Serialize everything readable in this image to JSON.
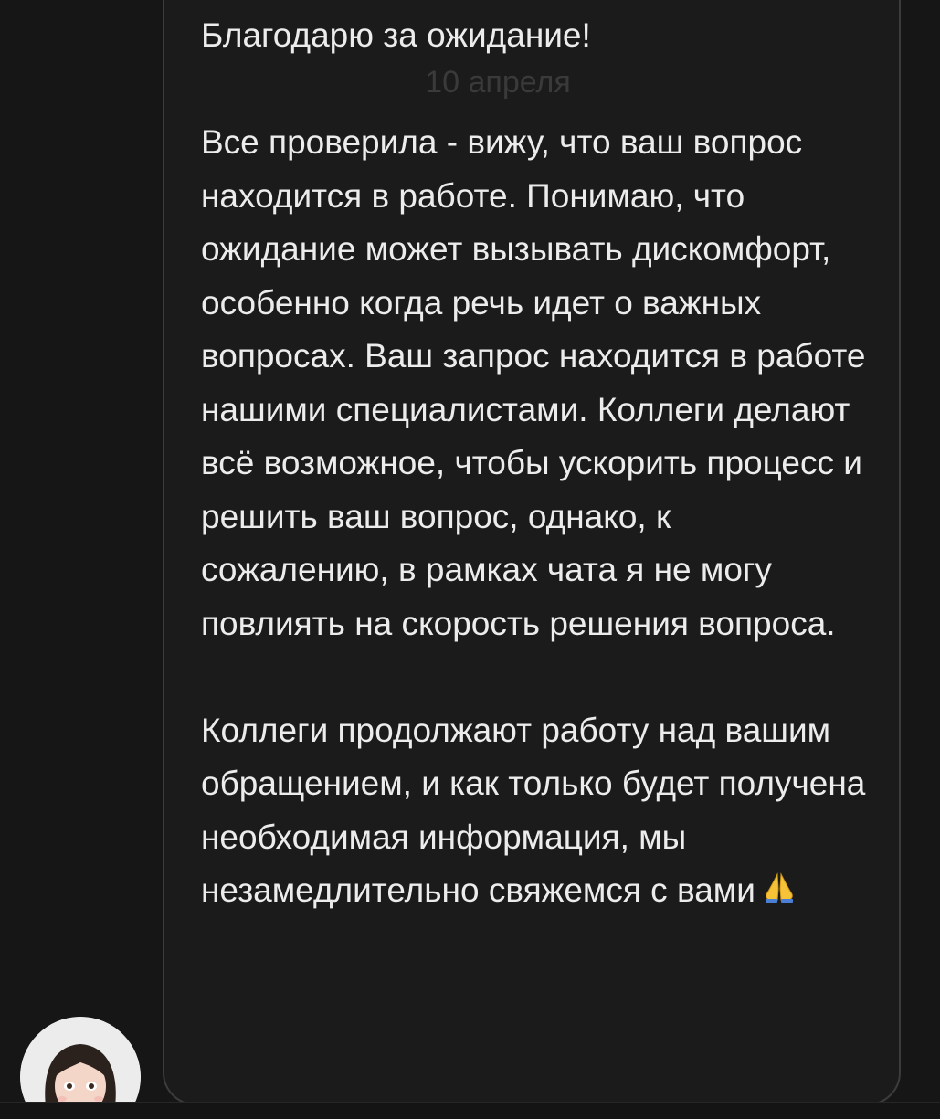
{
  "chat": {
    "date_separator": "10 апреля",
    "message": {
      "greeting": "Благодарю за ожидание!",
      "body": "Все проверила - вижу, что ваш вопрос находится в работе. Понимаю, что ожидание может вызывать дискомфорт, особенно когда речь идет о важных вопросах. Ваш запрос находится в работе нашими специалистами. Коллеги делают всё возможное, чтобы ускорить процесс и решить ваш вопрос, однако, к сожалению, в рамках чата я не могу повлиять на скорость решения вопроса.",
      "closing": "Коллеги продолжают работу над вашим обращением, и как только будет получена необходимая информация, мы незамедлительно свяжемся с вами",
      "emoji": "folded-hands-icon"
    },
    "colors": {
      "background": "#161616",
      "bubble_border": "#3c3c3c",
      "text": "#ececec"
    }
  }
}
